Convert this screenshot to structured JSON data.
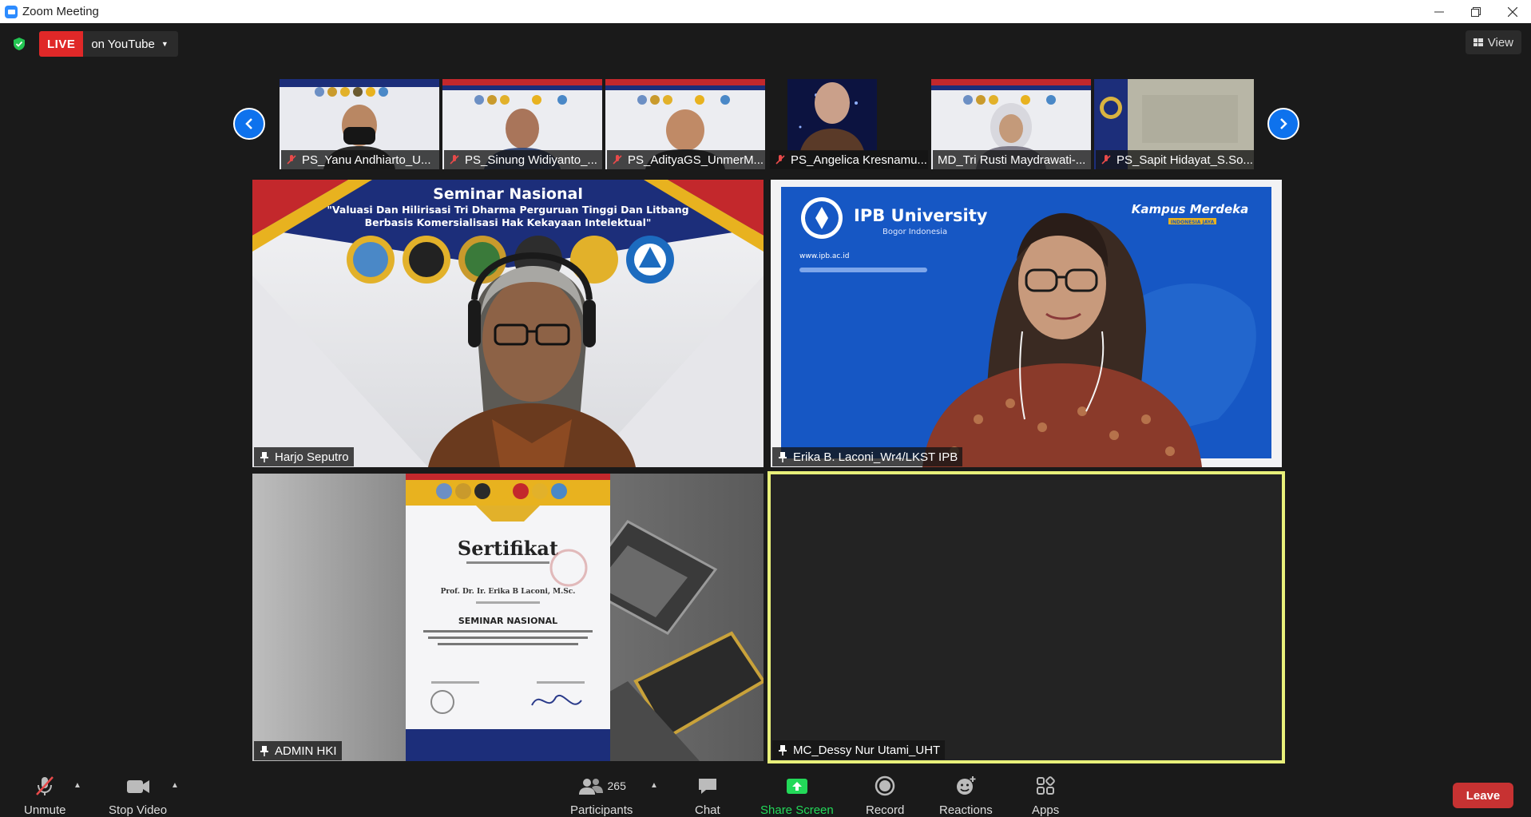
{
  "window": {
    "title": "Zoom Meeting"
  },
  "live": {
    "badge": "LIVE",
    "destination": "on YouTube"
  },
  "view": {
    "label": "View"
  },
  "filmstrip": [
    {
      "name": "PS_Yanu Andhiarto_U...",
      "muted": true
    },
    {
      "name": "PS_Sinung Widiyanto_...",
      "muted": true
    },
    {
      "name": "PS_AdityaGS_UnmerM...",
      "muted": true
    },
    {
      "name": "PS_Angelica Kresnamu...",
      "muted": true
    },
    {
      "name": "MD_Tri Rusti Maydrawati-...",
      "muted": false
    },
    {
      "name": "PS_Sapit Hidayat_S.So...",
      "muted": true
    }
  ],
  "tiles": {
    "harjo": {
      "name": "Harjo Seputro"
    },
    "erika": {
      "name": "Erika B. Laconi_Wr4/LKST IPB",
      "bg_title": "IPB University",
      "bg_subtitle": "Bogor Indonesia",
      "bg_url": "www.ipb.ac.id",
      "bg_brand": "Kampus Merdeka",
      "bg_brand_sub": "INDONESIA JAYA"
    },
    "admin": {
      "name": "ADMIN HKI",
      "cert_title": "Sertifikat",
      "cert_name": "Prof. Dr. Ir. Erika B Laconi, M.Sc.",
      "cert_event": "SEMINAR NASIONAL"
    },
    "mc": {
      "name": "MC_Dessy Nur Utami_UHT"
    }
  },
  "banner": {
    "title": "Seminar Nasional",
    "line1": "\"Valuasi Dan Hilirisasi Tri Dharma Perguruan Tinggi Dan Litbang",
    "line2": "Berbasis Komersialisasi Hak Kekayaan Intelektual\""
  },
  "toolbar": {
    "unmute": "Unmute",
    "stop_video": "Stop Video",
    "participants": "Participants",
    "participant_count": "265",
    "chat": "Chat",
    "share_screen": "Share Screen",
    "record": "Record",
    "reactions": "Reactions",
    "apps": "Apps",
    "leave": "Leave"
  },
  "colors": {
    "active_speaker_border": "#e8f07a",
    "share_green": "#23d959",
    "leave_red": "#c73232",
    "live_red": "#e02828",
    "nav_blue": "#0e72ed"
  }
}
